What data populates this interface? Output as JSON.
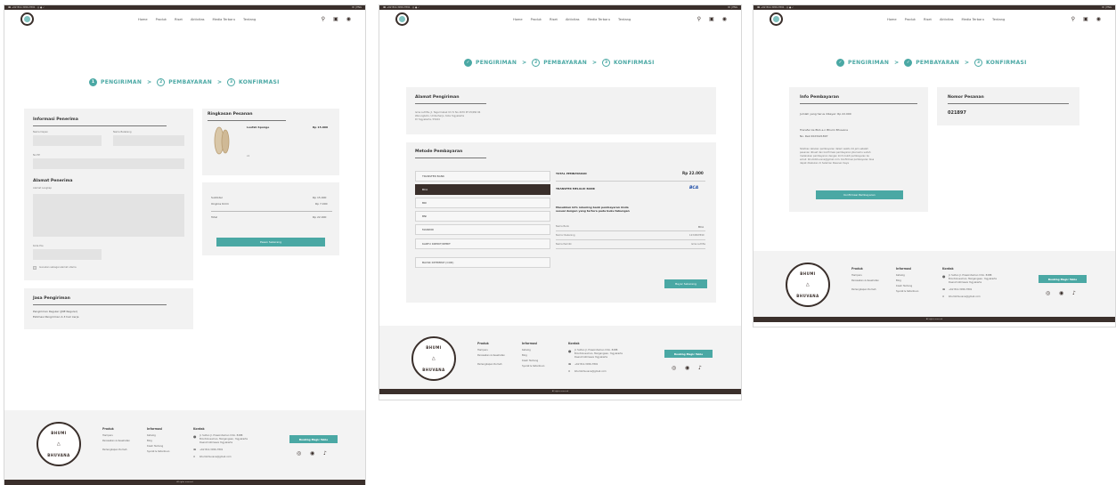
{
  "topbar": {
    "left": "☎ +62 812-3456-7891  ·  ◎ ● ✓",
    "right": "ID | ENG"
  },
  "nav": {
    "items": [
      "Home",
      "Produk",
      "Riset",
      "Aktivitas",
      "Media Terbaru",
      "Tentang"
    ]
  },
  "steps": {
    "s1": {
      "num": "1",
      "label": "PENGIRIMAN"
    },
    "s2": {
      "num": "2",
      "label": "PEMBAYARAN"
    },
    "s3": {
      "num": "3",
      "label": "KONFIRMASI"
    },
    "sep": ">",
    "check": "✓"
  },
  "shipping": {
    "info_title": "Informasi Penerima",
    "first_name": "Nama Depan",
    "last_name": "Nama Belakang",
    "phone": "No HP",
    "address_title": "Alamat Penerima",
    "full_address": "Alamat Lengkap",
    "postal": "Kode Pos",
    "save_default": "Gunakan sebagai alamat utama",
    "delivery_title": "Jasa Pengiriman",
    "delivery_line1": "Pengiriman Reguler (JNE Reguler)",
    "delivery_line2": "Estimasi Pengiriman 2-3 hari kerja"
  },
  "summary": {
    "title": "Ringkasan Pesanan",
    "product_name": "Loofah Sponge",
    "product_price": "Rp 15.000",
    "product_qty": "x1",
    "subtotal_label": "Subtotal",
    "subtotal": "Rp 15.000",
    "shipping_label": "Ongkos Kirim",
    "shipping": "Rp 7.000",
    "total_label": "Total",
    "total": "Rp 22.000",
    "order_button": "Pesan Sekarang"
  },
  "payment": {
    "address_title": "Alamat Pengiriman",
    "address_line1": "Isma Luthfia, Jl. Tegal Cabak Uh IV No.1670 RT 25/RW 06",
    "address_line2": "Warungboto, Umbulharjo, Kota Yogyakarta",
    "address_line3": "DI Yogyakarta, 55164",
    "method_title": "Metode Pembayaran",
    "methods": [
      "TRANSFER BANK",
      "BCA",
      "BRI",
      "BNI",
      "MANDIRI",
      "KARTU KREDIT/DEBIT",
      "BAYAR DITEMPAT (COD)"
    ],
    "total_label": "TOTAL PEMBAYARAN",
    "total_value": "Rp 22.000",
    "via_label": "TRANSFER MELALUI BANK",
    "bank_logo": "BCA",
    "instruction1": "Masukkan info rekening bank pembayaran Anda",
    "instruction2": "sesuai dengan yang tertera pada buku tabungan",
    "bank_name_label": "Nama Bank",
    "bank_name": "BCA",
    "account_no_label": "Nomor Rekening",
    "account_no": "1234567890",
    "owner_label": "Nama Pemilik",
    "owner": "Isma Luthfia",
    "pay_button": "Bayar Sekarang"
  },
  "confirm": {
    "info_title": "Info Pembayaran",
    "amount_text": "Jumlah yang harus dibayar: Rp 22.000",
    "transfer_line1": "Transfer ke BCA a.n Bhumi Bhuvana",
    "transfer_line2": "No. Rek 0023421897",
    "note_line1": "Silahkan lakukan pembayaran dalam waktu 24 jam setelah",
    "note_line2": "pesanan dibuat dan konfirmasi pembayaran jika kamu sudah",
    "note_line3": "melakukan pembayaran dengan kirim bukti pembayaran ke",
    "note_line4": "email: bhumibhuvana@gmail.com. Konfirmasi pembayaran bisa",
    "note_line5": "dapat dilakukan di halaman Pesanan Saya",
    "confirm_button": "Konfirmasi Pembayaran",
    "order_title": "Nomor Pesanan",
    "order_number": "021897"
  },
  "footer": {
    "badge_top": "BHUMI",
    "badge_bottom": "BHUVANA",
    "produk_title": "Produk",
    "produk_items": [
      "Hampers",
      "Perawatan & Kesehatan",
      "Perlengkapan Rumah"
    ],
    "info_title": "Informasi",
    "info_items": [
      "Katalog",
      "Blog",
      "Kisah Tentang",
      "Syarat & Ketentuan"
    ],
    "contact_title": "Kontak",
    "address1": "Jl. Sultan Jl. Prawirotaman II No. 848B",
    "address2": "Brontokusuman, Mergangsan, Yogyakarta",
    "address3": "Daerah Istimewa Yogyakarta",
    "phone": "+62 812-3456-7891",
    "email": "bhumibhuvana@gmail.com",
    "booking_button": "Booking Magic Table",
    "copyright": "All rights reserved"
  }
}
